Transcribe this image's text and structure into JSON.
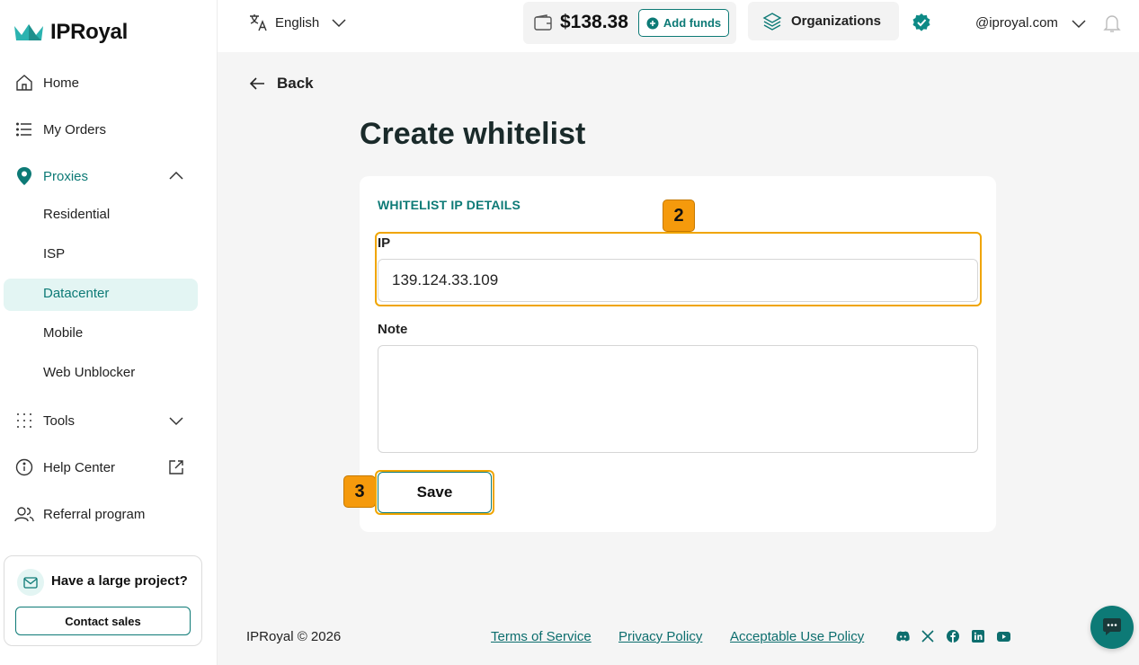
{
  "brand": {
    "name": "IPRoyal",
    "accent": "#0d7a76",
    "highlight": "#f0a500"
  },
  "sidebar": {
    "items": [
      {
        "label": "Home",
        "icon": "home-icon"
      },
      {
        "label": "My Orders",
        "icon": "list-icon"
      },
      {
        "label": "Proxies",
        "icon": "location-pin-icon"
      },
      {
        "label": "Tools",
        "icon": "grid-dots-icon"
      },
      {
        "label": "Help Center",
        "icon": "info-icon"
      },
      {
        "label": "Referral program",
        "icon": "users-icon"
      }
    ],
    "proxies_sub": [
      "Residential",
      "ISP",
      "Datacenter",
      "Mobile",
      "Web Unblocker"
    ],
    "active_sub": "Datacenter",
    "promo": {
      "title": "Have a large project?",
      "button": "Contact sales"
    }
  },
  "topbar": {
    "language": "English",
    "balance": "$138.38",
    "add_funds": "Add funds",
    "organizations": "Organizations",
    "email": "@iproyal.com"
  },
  "main": {
    "back": "Back",
    "title": "Create whitelist",
    "section_title": "WHITELIST IP DETAILS",
    "ip_label": "IP",
    "ip_value": "139.124.33.109",
    "note_label": "Note",
    "note_value": "",
    "save": "Save",
    "badges": [
      "2",
      "3"
    ]
  },
  "footer": {
    "copyright": "IPRoyal © 2026",
    "links": [
      "Terms of Service",
      "Privacy Policy",
      "Acceptable Use Policy"
    ],
    "social": [
      "discord-icon",
      "x-icon",
      "facebook-icon",
      "linkedin-icon",
      "youtube-icon"
    ]
  }
}
